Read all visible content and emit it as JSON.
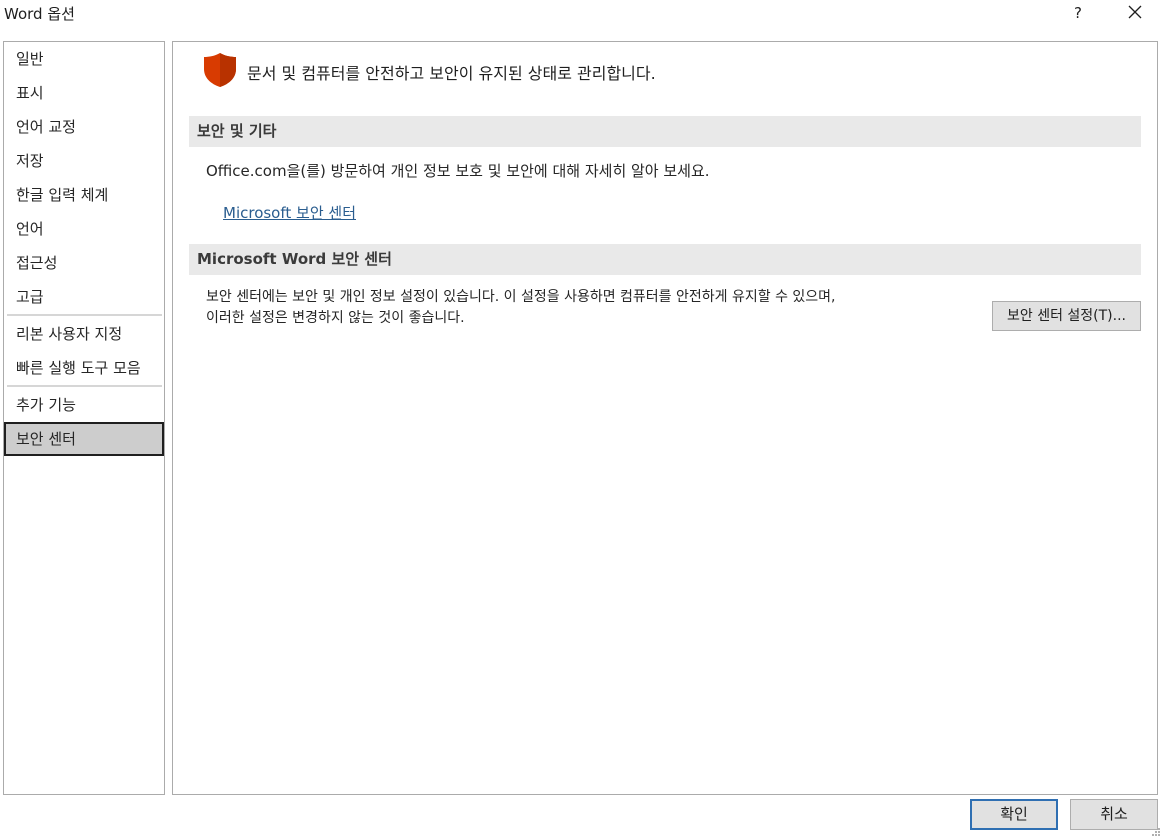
{
  "window": {
    "title": "Word 옵션",
    "help_label": "?"
  },
  "sidebar": {
    "items": [
      {
        "label": "일반"
      },
      {
        "label": "표시"
      },
      {
        "label": "언어 교정"
      },
      {
        "label": "저장"
      },
      {
        "label": "한글 입력 체계"
      },
      {
        "label": "언어"
      },
      {
        "label": "접근성"
      },
      {
        "label": "고급"
      },
      {
        "label": "리본 사용자 지정"
      },
      {
        "label": "빠른 실행 도구 모음"
      },
      {
        "label": "추가 기능"
      },
      {
        "label": "보안 센터"
      }
    ],
    "selected": "보안 센터"
  },
  "main": {
    "header": "문서 및 컴퓨터를 안전하고 보안이 유지된 상태로 관리합니다.",
    "sections": [
      {
        "title": "보안 및 기타",
        "text": "Office.com을(를) 방문하여 개인 정보 보호 및 보안에 대해 자세히 알아 보세요.",
        "link": "Microsoft 보안 센터"
      },
      {
        "title": "Microsoft Word 보안 센터",
        "text_line1": "보안 센터에는 보안 및 개인 정보 설정이 있습니다. 이 설정을 사용하면 컴퓨터를 안전하게 유지할 수 있으며,",
        "text_line2": "이러한 설정은 변경하지 않는 것이 좋습니다.",
        "button": "보안 센터 설정(T)..."
      }
    ]
  },
  "footer": {
    "ok_label": "확인",
    "cancel_label": "취소"
  },
  "colors": {
    "shield": "#d83b01",
    "link": "#2a5d8f",
    "selected_bg": "#cdcdcd",
    "section_bg": "#e9e9e9"
  }
}
